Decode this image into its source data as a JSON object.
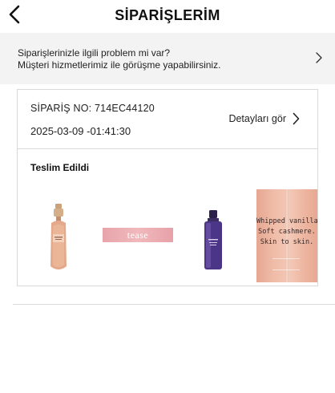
{
  "header": {
    "title": "SİPARİŞLERİM",
    "back_icon": "chevron-left-icon"
  },
  "help_banner": {
    "line1": "Siparişlerinizle ilgili problem mi var?",
    "line2": "Müşteri hizmetlerimiz ile görüşme yapabilirsiniz.",
    "icon": "chevron-right-icon"
  },
  "order": {
    "number_label": "SİPARİŞ NO: 714EC44120",
    "date": "2025-03-09 -01:41:30",
    "details_label": "Detayları gör",
    "status": "Teslim Edildi",
    "items": [
      {
        "name": "rose-gold-body-mist-bottle",
        "colors": [
          "#e8b49a",
          "#c98b6f",
          "#d8b08a"
        ]
      },
      {
        "name": "tease-fragrance-banner",
        "text": "tease",
        "colors": [
          "#e7a4aa"
        ]
      },
      {
        "name": "purple-fragrance-bottle",
        "colors": [
          "#3b2a6b",
          "#7c5fb8"
        ]
      },
      {
        "name": "cashmere-promo-image",
        "text_lines": [
          "Whipped vanilla",
          "Soft cashmere.",
          "Skin to skin."
        ],
        "colors": [
          "#f0bda9"
        ]
      }
    ]
  },
  "colors": {
    "banner_bg": "#f3f3f4",
    "border": "#d9d9d9",
    "text": "#1a1a1a"
  }
}
